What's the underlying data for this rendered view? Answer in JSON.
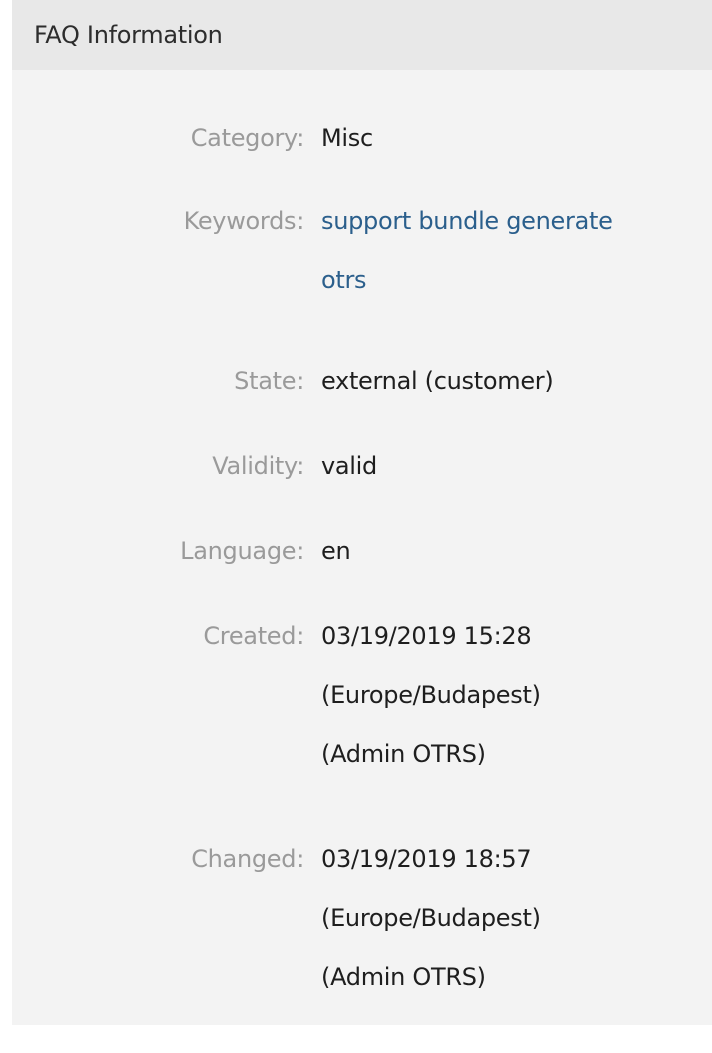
{
  "widget": {
    "title": "FAQ Information"
  },
  "fields": {
    "category": {
      "label": "Category:",
      "value": "Misc"
    },
    "keywords": {
      "label": "Keywords:",
      "line1": "support bundle generate",
      "line2": "otrs"
    },
    "state": {
      "label": "State:",
      "value": "external (customer)"
    },
    "validity": {
      "label": "Validity:",
      "value": "valid"
    },
    "language": {
      "label": "Language:",
      "value": "en"
    },
    "created": {
      "label": "Created:",
      "line1": "03/19/2019 15:28",
      "line2": "(Europe/Budapest)",
      "line3": "(Admin OTRS)"
    },
    "changed": {
      "label": "Changed:",
      "line1": "03/19/2019 18:57",
      "line2": "(Europe/Budapest)",
      "line3": "(Admin OTRS)"
    }
  },
  "colors": {
    "panel_background": "#f3f3f3",
    "header_background": "#e8e8e8",
    "label_text": "#9a9a9a",
    "value_text": "#1e1e1e",
    "link_text": "#2b5f8c"
  }
}
